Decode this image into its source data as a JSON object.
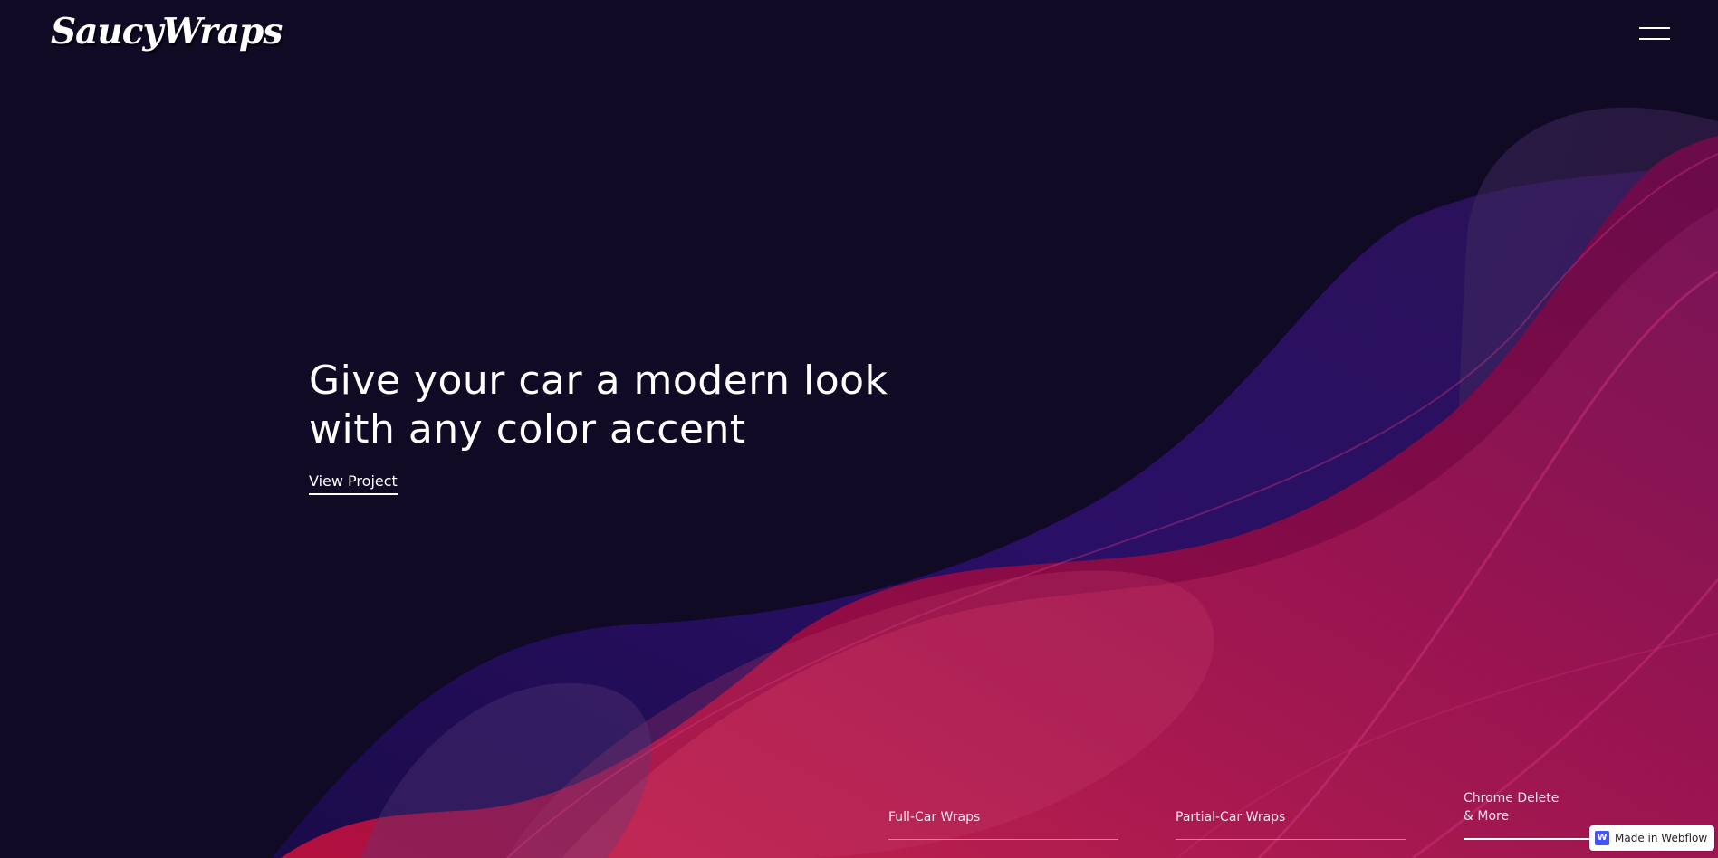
{
  "brand": {
    "logo_text": "SaucyWraps"
  },
  "header": {
    "menu_icon": "hamburger-menu-icon"
  },
  "hero": {
    "title": "Give your car a modern look with any color accent",
    "link_label": "View Project"
  },
  "services": [
    {
      "label": "Full-Car Wraps",
      "active": false
    },
    {
      "label": "Partial-Car Wraps",
      "active": false
    },
    {
      "label": "Chrome Delete\n& More",
      "active": true
    }
  ],
  "badge": {
    "label": "Made in Webflow",
    "icon": "webflow-icon",
    "icon_letter": "W"
  },
  "colors": {
    "background": "#110a25",
    "wave_purple": "#2a0e5e",
    "wave_crimson": "#8e0c44",
    "wave_pink": "#b0144f",
    "text": "#ffffff",
    "badge_accent": "#4353ff"
  }
}
